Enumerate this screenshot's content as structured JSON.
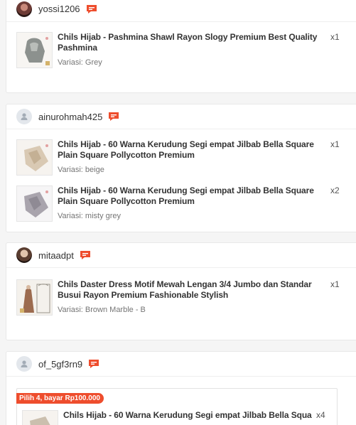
{
  "orders": [
    {
      "username": "yossi1206",
      "items": [
        {
          "title": "Chils Hijab - Pashmina Shawl Rayon Slogy Premium Best Quality Pashmina",
          "variation": "Variasi: Grey",
          "qty": "x1"
        }
      ],
      "edge": "R",
      "edge_sub": "S"
    },
    {
      "username": "ainurohmah425",
      "items": [
        {
          "title": "Chils Hijab - 60 Warna Kerudung Segi empat Jilbab Bella Square Plain Square Pollycotton Premium",
          "variation": "Variasi: beige",
          "qty": "x1"
        },
        {
          "title": "Chils Hijab - 60 Warna Kerudung Segi empat Jilbab Bella Square Plain Square Pollycotton Premium",
          "variation": "Variasi: misty grey",
          "qty": "x2"
        }
      ],
      "edge": "R",
      "edge_sub": "C"
    },
    {
      "username": "mitaadpt",
      "items": [
        {
          "title": "Chils Daster Dress Motif Mewah Lengan 3/4 Jumbo dan Standar Busui Rayon Premium Fashionable Stylish",
          "variation": "Variasi: Brown Marble - B",
          "qty": "x1"
        }
      ],
      "edge": "R",
      "edge_sub": "S"
    },
    {
      "username": "of_5gf3rn9",
      "promo": "Pilih 4, bayar Rp100.000",
      "items": [
        {
          "title": "Chils Hijab - 60 Warna Kerudung Segi empat Jilbab Bella Squar",
          "variation": "",
          "qty": "x4"
        }
      ],
      "edge": "R",
      "edge_sub": "C"
    }
  ],
  "icons": {
    "chat": "chat-bubble-icon",
    "avatar_default": "person-icon"
  },
  "colors": {
    "accent": "#ee4d2d",
    "border": "#e8e8e8"
  }
}
